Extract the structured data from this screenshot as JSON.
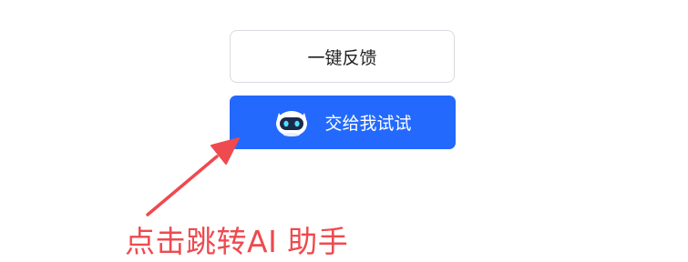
{
  "buttons": {
    "feedback_label": "一键反馈",
    "ai_label": "交给我试试"
  },
  "annotation": {
    "text": "点击跳转AI 助手"
  },
  "icons": {
    "ai_button_icon": "robot-icon",
    "pointer": "arrow-icon"
  },
  "colors": {
    "primary": "#2369fd",
    "annotation": "#ee4a4f",
    "border": "#d9dbe0"
  }
}
